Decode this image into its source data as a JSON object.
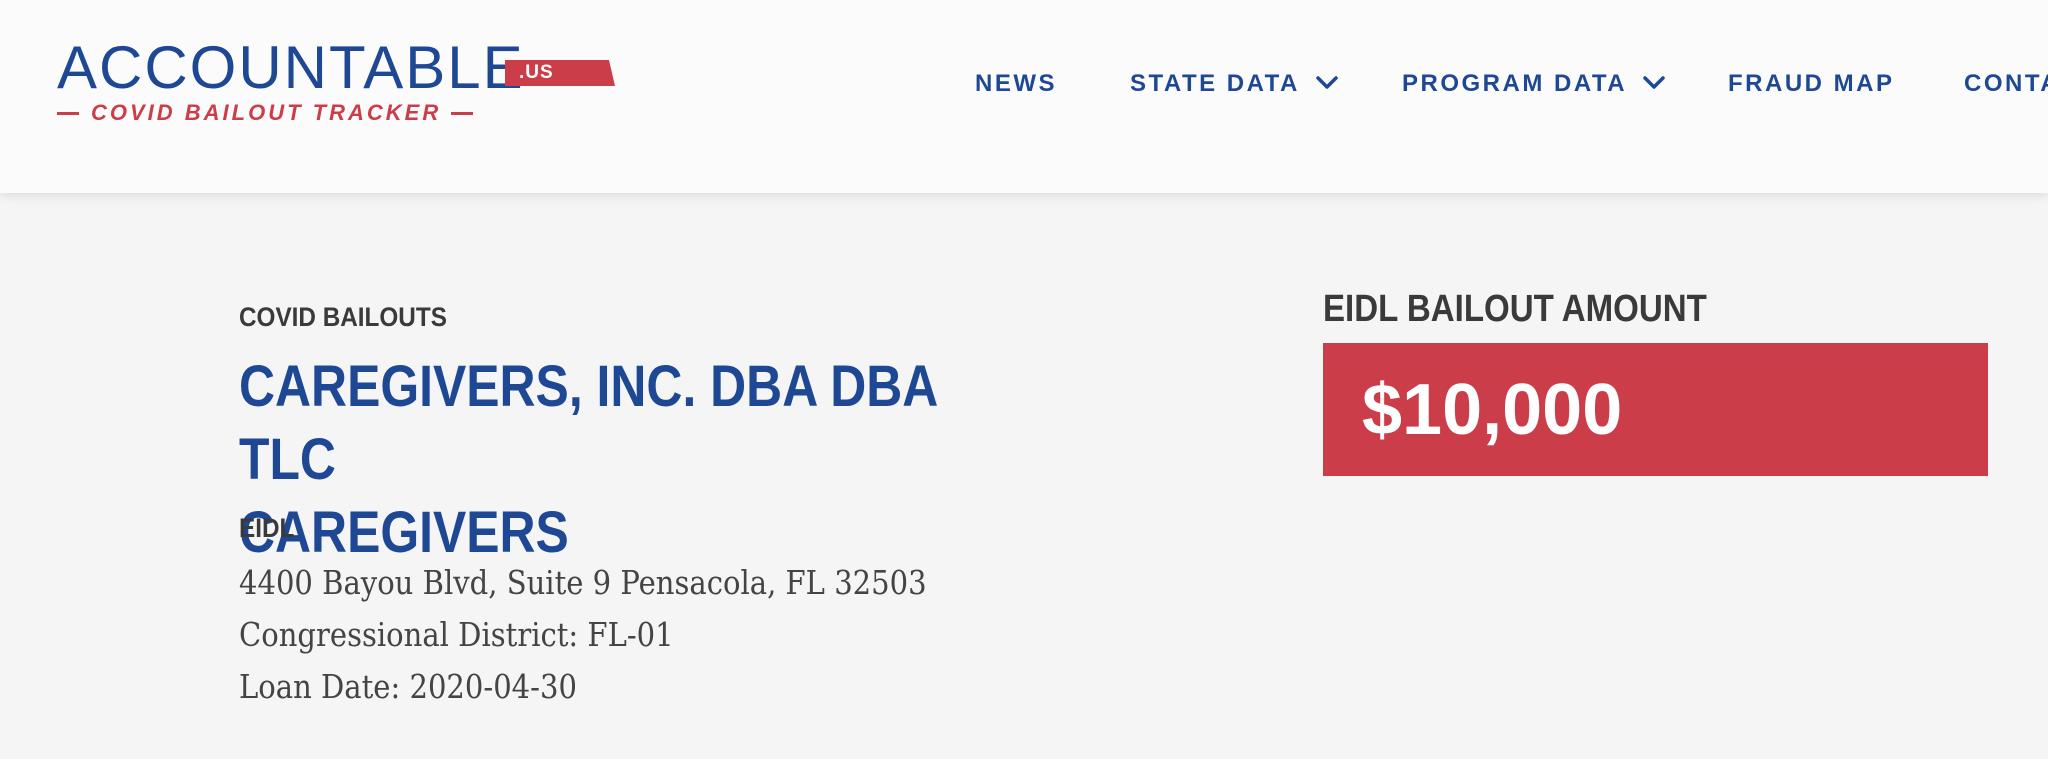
{
  "header": {
    "logo": {
      "main": "ACCOUNTABLE",
      "tld": ".US",
      "tagline": "COVID BAILOUT TRACKER"
    },
    "nav": [
      {
        "label": "NEWS",
        "has_dropdown": false
      },
      {
        "label": "STATE DATA",
        "has_dropdown": true,
        "icon": "chevron-down-icon"
      },
      {
        "label": "PROGRAM DATA",
        "has_dropdown": true,
        "icon": "chevron-down-icon"
      },
      {
        "label": "FRAUD MAP",
        "has_dropdown": false
      },
      {
        "label": "CONTA",
        "has_dropdown": false
      }
    ]
  },
  "main": {
    "eyebrow": "COVID BAILOUTS",
    "title_line1": "CAREGIVERS, INC. DBA DBA TLC",
    "title_line2": "CAREGIVERS",
    "program": "EIDL",
    "address": "4400 Bayou Blvd, Suite 9 Pensacola, FL 32503",
    "district": "Congressional District: FL-01",
    "loan_date": "Loan Date: 2020-04-30",
    "amount_label": "EIDL BAILOUT AMOUNT",
    "amount_value": "$10,000"
  },
  "colors": {
    "brand_blue": "#1e4894",
    "brand_red": "#cc3d4a",
    "text_dark": "#3a3a3a",
    "page_bg": "#f5f5f5",
    "header_bg": "#fbfbfb"
  }
}
